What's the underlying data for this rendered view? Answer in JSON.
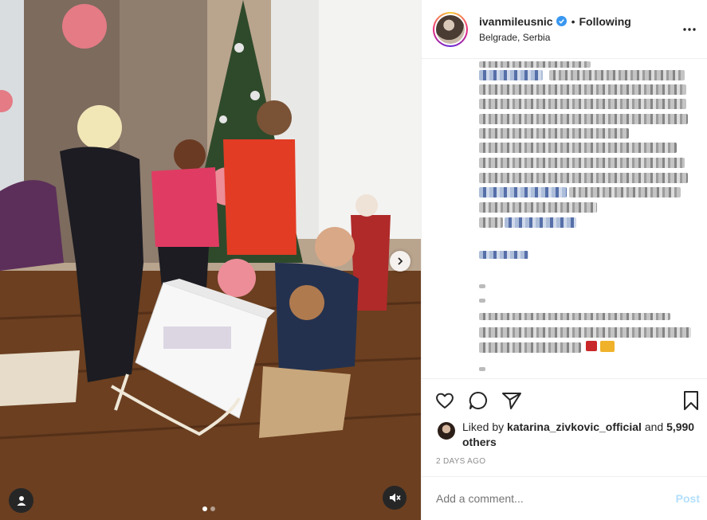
{
  "post": {
    "username": "ivanmileusnic",
    "separator": "•",
    "follow_status": "Following",
    "location": "Belgrade, Serbia",
    "more_icon": "ellipsis-icon"
  },
  "media": {
    "carousel_count": 2,
    "active_index": 0,
    "user_tag_icon": "user-icon",
    "mute_icon": "speaker-muted-icon",
    "next_icon": "chevron-right-icon"
  },
  "actions": {
    "like_icon": "heart-icon",
    "comment_icon": "comment-bubble-icon",
    "share_icon": "paper-plane-icon",
    "save_icon": "bookmark-icon"
  },
  "likes": {
    "prefix": "Liked by",
    "liker": "katarina_zivkovic_official",
    "conjunction": "and",
    "others": "5,990 others"
  },
  "timestamp": "2 DAYS AGO",
  "comment": {
    "placeholder": "Add a comment...",
    "post_label": "Post"
  },
  "colors": {
    "verified_blue": "#3897f0",
    "post_disabled": "#b2dffc",
    "muted_text": "#8e8e8e"
  }
}
